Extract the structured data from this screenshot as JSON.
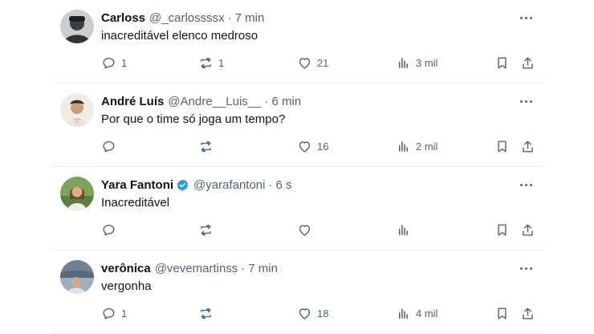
{
  "tweets": [
    {
      "name": "Carloss",
      "handle": "@_carlossssx",
      "sep": "·",
      "time": "7 min",
      "text": "inacreditável elenco medroso",
      "verified": false,
      "replies": "1",
      "retweets": "1",
      "likes": "21",
      "views": "3 mil",
      "avatar_color": "#2f3338"
    },
    {
      "name": "André Luís",
      "handle": "@Andre__Luis__",
      "sep": "·",
      "time": "6 min",
      "text": "Por que o time só joga um tempo?",
      "verified": false,
      "replies": "",
      "retweets": "",
      "likes": "16",
      "views": "2 mil",
      "avatar_color": "#e6dccb"
    },
    {
      "name": "Yara Fantoni",
      "handle": "@yarafantoni",
      "sep": "·",
      "time": "6 s",
      "text": "Inacreditável",
      "verified": true,
      "replies": "",
      "retweets": "",
      "likes": "",
      "views": "",
      "avatar_color": "#6f8a4a"
    },
    {
      "name": "verônica",
      "handle": "@vevemartinss",
      "sep": "·",
      "time": "7 min",
      "text": "vergonha",
      "verified": false,
      "replies": "1",
      "retweets": "",
      "likes": "18",
      "views": "4 mil",
      "avatar_color": "#7d8c9a"
    }
  ],
  "colors": {
    "text": "#0f1419",
    "secondary": "#536471",
    "verified": "#1d9bf0",
    "divider": "#eff3f4"
  },
  "icons": [
    "reply-icon",
    "retweet-icon",
    "like-icon",
    "views-icon",
    "bookmark-icon",
    "share-icon",
    "more-icon",
    "verified-badge-icon"
  ]
}
